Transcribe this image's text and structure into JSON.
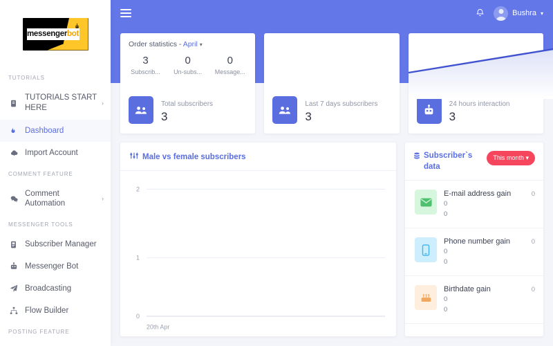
{
  "brand": {
    "logo_text_primary": "messenger",
    "logo_text_accent": "bot",
    "logo_badge_icon": "bot-face-icon"
  },
  "colors": {
    "accent_blue": "#6377e8",
    "link_blue": "#5a6ee0",
    "pill_red": "#f6465d",
    "page_bg": "#f4f5fa",
    "card_bg": "#ffffff"
  },
  "sidebar": {
    "sections": [
      {
        "label": "TUTORIALS",
        "items": [
          {
            "label": "TUTORIALS START HERE",
            "icon": "book-icon",
            "chevron": "›",
            "active": false
          },
          {
            "label": "Dashboard",
            "icon": "flame-icon",
            "chevron": "",
            "active": true
          },
          {
            "label": "Import Account",
            "icon": "cloud-download-icon",
            "chevron": "",
            "active": false
          }
        ]
      },
      {
        "label": "COMMENT FEATURE",
        "items": [
          {
            "label": "Comment Automation",
            "icon": "comments-icon",
            "chevron": "›",
            "active": false
          }
        ]
      },
      {
        "label": "MESSENGER TOOLS",
        "items": [
          {
            "label": "Subscriber Manager",
            "icon": "id-card-icon",
            "chevron": "",
            "active": false
          },
          {
            "label": "Messenger Bot",
            "icon": "robot-icon",
            "chevron": "",
            "active": false
          },
          {
            "label": "Broadcasting",
            "icon": "paper-plane-icon",
            "chevron": "",
            "active": false
          },
          {
            "label": "Flow Builder",
            "icon": "sitemap-icon",
            "chevron": "",
            "active": false
          }
        ]
      },
      {
        "label": "POSTING FEATURE",
        "items": []
      }
    ]
  },
  "topbar": {
    "menu_icon": "hamburger-icon",
    "bell_icon": "bell-icon",
    "user_name": "Bushra",
    "caret": "▾"
  },
  "stats": {
    "order_statistics": {
      "title": "Order statistics -",
      "month": "April",
      "caret": "▾",
      "metrics": [
        {
          "value": "3",
          "label": "Subscrib..."
        },
        {
          "value": "0",
          "label": "Un-subs..."
        },
        {
          "value": "0",
          "label": "Message..."
        }
      ],
      "footer": {
        "label": "Total subscribers",
        "value": "3",
        "icon": "users-icon"
      }
    },
    "last_7_days": {
      "footer": {
        "label": "Last 7 days subscribers",
        "value": "3",
        "icon": "users-icon"
      }
    },
    "interaction_24h": {
      "footer": {
        "label": "24 hours interaction",
        "value": "3",
        "icon": "robot-icon"
      }
    }
  },
  "chart_data": {
    "type": "bar",
    "title": "Male vs female subscribers",
    "icon": "sliders-icon",
    "categories": [
      "20th Apr"
    ],
    "series": [
      {
        "name": "Male",
        "values": [
          0
        ]
      },
      {
        "name": "Female",
        "values": [
          0
        ]
      }
    ],
    "values": [
      0
    ],
    "xlabel": "",
    "ylabel": "",
    "ylim": [
      0,
      2
    ],
    "yticks": [
      "0",
      "1",
      "2"
    ],
    "xticks": [
      "20th Apr"
    ],
    "grid": true,
    "legend": "none"
  },
  "sparkline": {
    "type": "area",
    "points": [
      [
        0,
        55
      ],
      [
        100,
        24
      ]
    ],
    "line_color": "#4152cf",
    "fill_from": "#dfe3f8",
    "fill_to": "#ffffff"
  },
  "subscriber_data": {
    "title": "Subscriber`s data",
    "icon": "database-icon",
    "filter_label": "This month",
    "filter_caret": "▾",
    "rows": [
      {
        "name": "E-mail address gain",
        "icon": "envelope-icon",
        "icon_bg": "#d6f6dd",
        "icon_color": "#4fc06d",
        "right_value": "0",
        "sub_values": [
          "0",
          "0"
        ]
      },
      {
        "name": "Phone number gain",
        "icon": "mobile-icon",
        "icon_bg": "#cdeefc",
        "icon_color": "#4bb6e8",
        "right_value": "0",
        "sub_values": [
          "0",
          "0"
        ]
      },
      {
        "name": "Birthdate gain",
        "icon": "birthday-cake-icon",
        "icon_bg": "#fdeedd",
        "icon_color": "#f0a860",
        "right_value": "0",
        "sub_values": [
          "0",
          "0"
        ]
      }
    ]
  }
}
